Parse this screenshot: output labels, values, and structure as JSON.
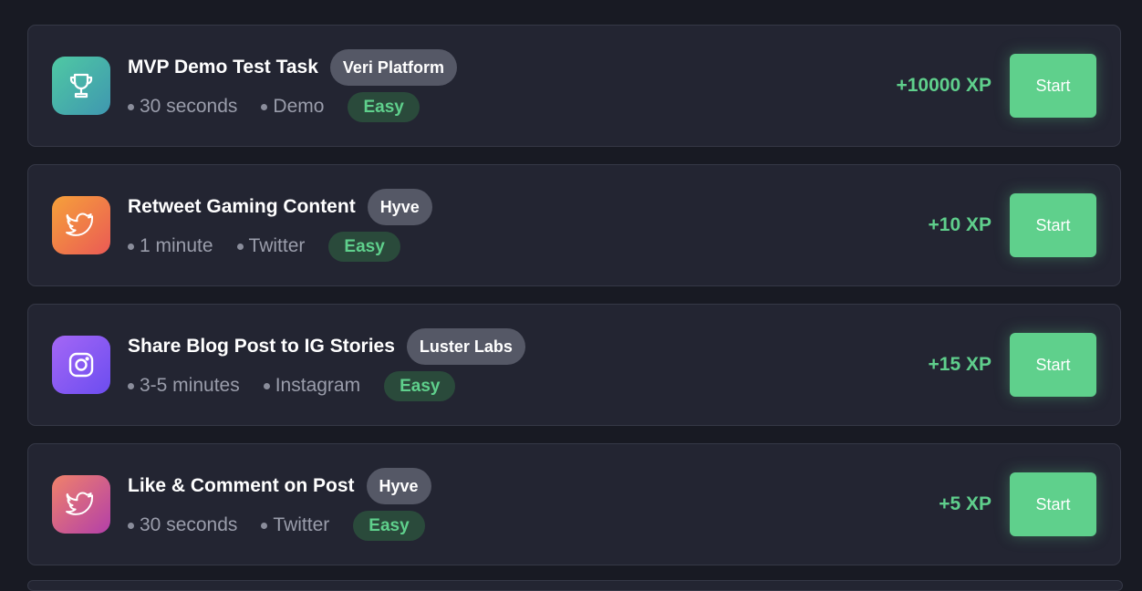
{
  "tasks": [
    {
      "title": "MVP Demo Test Task",
      "platform": "Veri Platform",
      "duration": "30 seconds",
      "category": "Demo",
      "difficulty": "Easy",
      "reward": "+10000 XP",
      "button_label": "Start",
      "icon": "trophy-icon",
      "icon_gradient": [
        "#4fc9a3",
        "#3f97b0"
      ]
    },
    {
      "title": "Retweet Gaming Content",
      "platform": "Hyve",
      "duration": "1 minute",
      "category": "Twitter",
      "difficulty": "Easy",
      "reward": "+10 XP",
      "button_label": "Start",
      "icon": "twitter-bird-icon",
      "icon_gradient": [
        "#f6a13a",
        "#ea5a55"
      ]
    },
    {
      "title": "Share Blog Post to IG Stories",
      "platform": "Luster Labs",
      "duration": "3-5 minutes",
      "category": "Instagram",
      "difficulty": "Easy",
      "reward": "+15 XP",
      "button_label": "Start",
      "icon": "instagram-icon",
      "icon_gradient": [
        "#a467f5",
        "#6c4df0"
      ]
    },
    {
      "title": "Like & Comment on Post",
      "platform": "Hyve",
      "duration": "30 seconds",
      "category": "Twitter",
      "difficulty": "Easy",
      "reward": "+5 XP",
      "button_label": "Start",
      "icon": "twitter-bird-icon",
      "icon_gradient": [
        "#f0826a",
        "#b33fa9"
      ]
    }
  ],
  "colors": {
    "background": "#181a23",
    "card": "#232532",
    "accent_green": "#5fd08c",
    "difficulty_bg": "#2a4a3b",
    "platform_tag_bg": "#555866",
    "muted_text": "#9a9dab"
  }
}
